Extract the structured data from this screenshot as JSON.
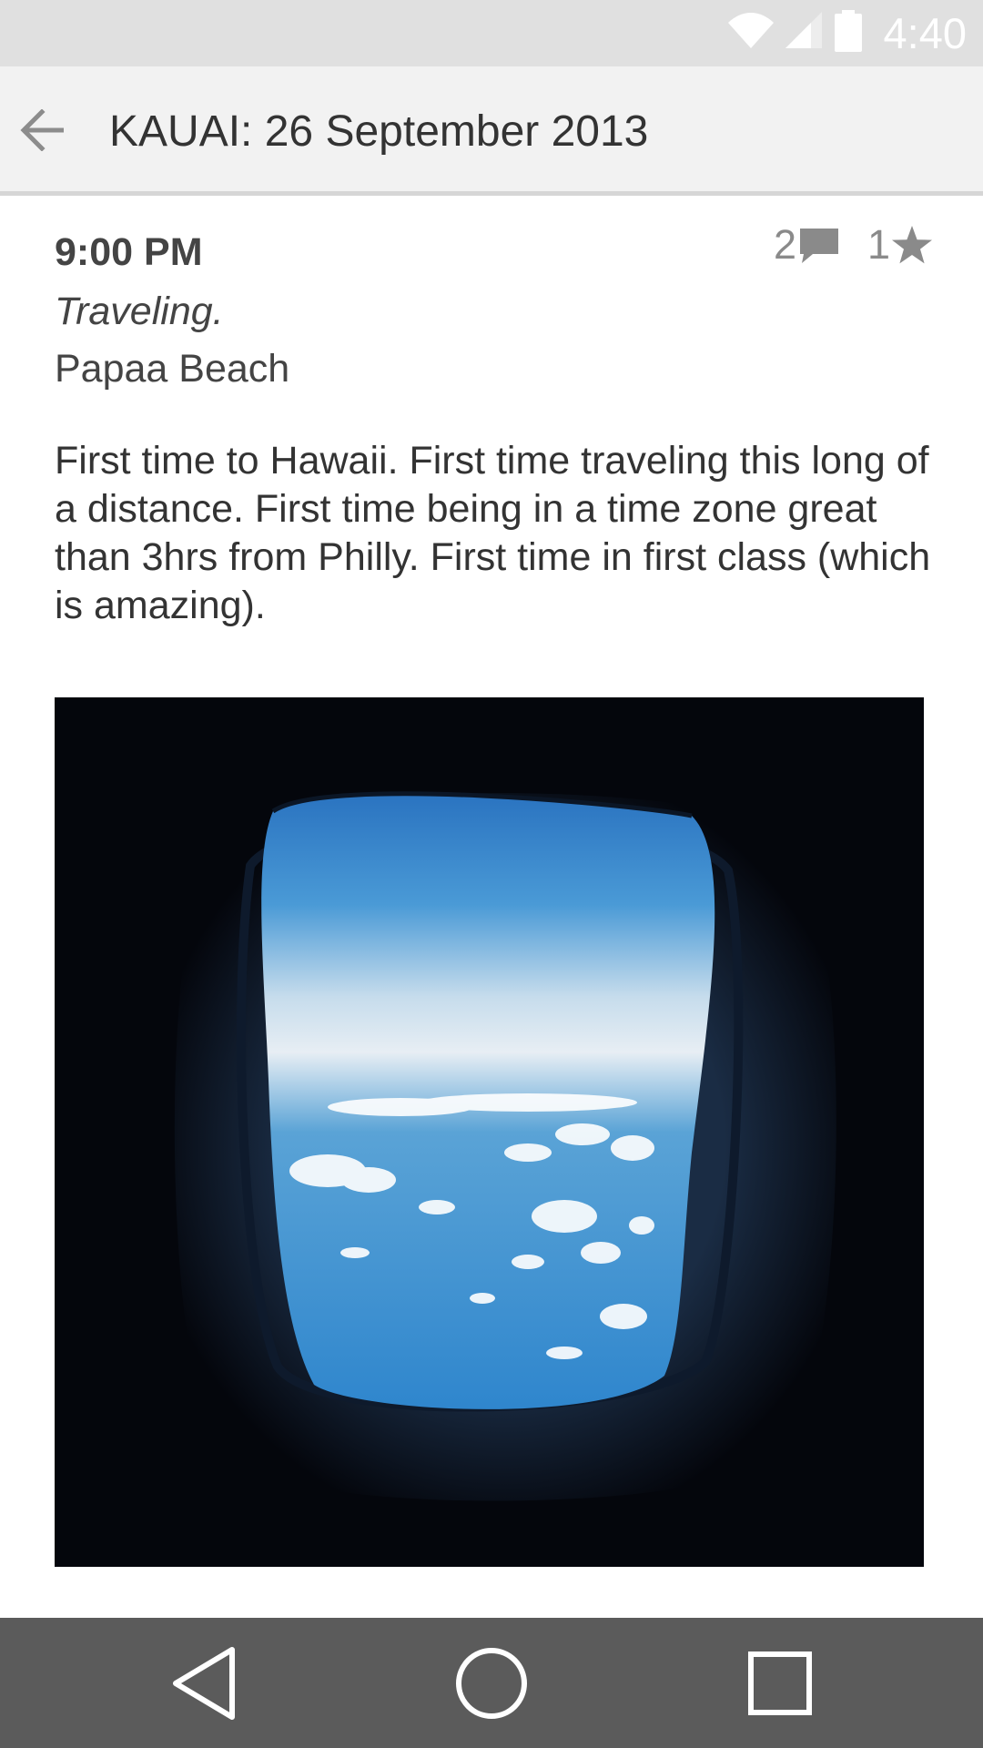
{
  "status_bar": {
    "time": "4:40",
    "icons": [
      "wifi-icon",
      "cell-signal-icon",
      "battery-icon"
    ]
  },
  "toolbar": {
    "title": "KAUAI: 26 September 2013",
    "back_icon": "back-arrow-icon"
  },
  "entry": {
    "time": "9:00 PM",
    "mood": "Traveling.",
    "location": "Papaa Beach",
    "comment_count": "2",
    "star_count": "1",
    "body": "First time to Hawaii. First time traveling this long of a distance. First time being in a time zone great than 3hrs from Philly. First time in first class (which is amazing)."
  },
  "nav_bar": {
    "buttons": [
      "back-nav-icon",
      "home-nav-icon",
      "recents-nav-icon"
    ]
  },
  "colors": {
    "status_bar": "#e0e0e0",
    "toolbar": "#f2f2f2",
    "nav_bar": "#5b5b5b",
    "text": "#333333",
    "counter": "#8a8a8a"
  }
}
